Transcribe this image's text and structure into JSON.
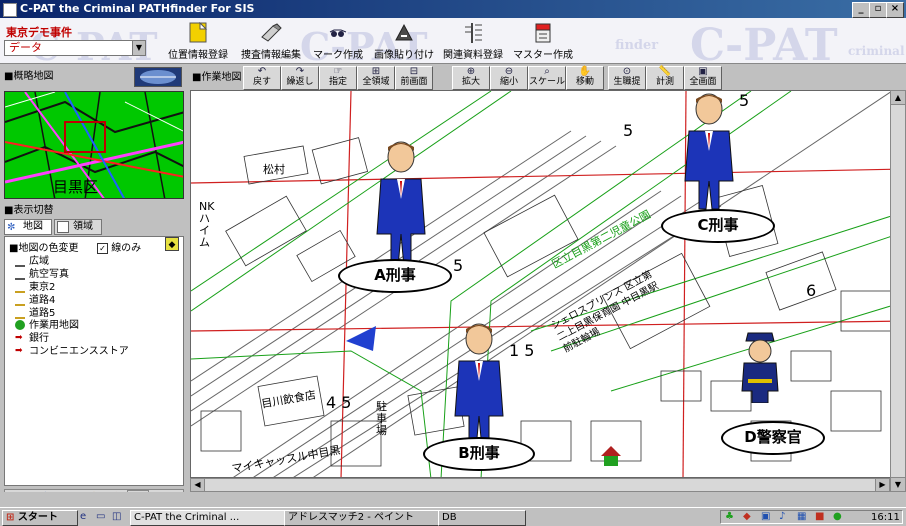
{
  "window": {
    "title": "C-PAT the Criminal PATHfinder For SIS"
  },
  "header": {
    "case_name": "東京デモ事件",
    "data_select": "データ",
    "watermark": "C-PAT",
    "watermark_suffix": "criminal",
    "watermark_fragment": "finder"
  },
  "toolbar": {
    "buttons": [
      {
        "label": "位置情報登録",
        "icon": "location-register-icon"
      },
      {
        "label": "捜査情報編集",
        "icon": "investigation-edit-icon"
      },
      {
        "label": "マーク作成",
        "icon": "mark-create-icon"
      },
      {
        "label": "画像貼り付け",
        "icon": "image-paste-icon"
      },
      {
        "label": "関連資料登録",
        "icon": "document-register-icon"
      },
      {
        "label": "マスター作成",
        "icon": "master-create-icon"
      }
    ]
  },
  "overview": {
    "title": "■概略地図",
    "area_label": "目黒区"
  },
  "display": {
    "title": "■表示切替",
    "tabs": [
      "地図",
      "領域"
    ],
    "color_change": "■地図の色変更",
    "lines_only": "線のみ",
    "layers": [
      "広域",
      "航空写真",
      "東京2",
      "道路4",
      "道路5",
      "作業用地図",
      "銀行",
      "コンビニエンスストア"
    ]
  },
  "map": {
    "title": "■作業地図",
    "tools": [
      "戻す",
      "繰返し",
      "指定",
      "全領域",
      "前画面",
      "拡大",
      "縮小",
      "スケール",
      "移動",
      "生職提",
      "計測",
      "全画面"
    ],
    "labels": {
      "a": "A刑事",
      "b": "B刑事",
      "c": "C刑事",
      "d": "D警察官",
      "matsumura": "松村",
      "heim": "NKハイム",
      "station": "区立目黒第二児童公園",
      "school": "シェロスプリンス 区立第二上目黒保育園 中目黒駅前駐輪場",
      "kawa": "目川飲食店",
      "parking": "駐車場",
      "meguro": "マイキャッスル中目黒",
      "num15": "1 5",
      "num45": "4 5",
      "num5": "5",
      "num6": "6"
    }
  },
  "taskbar": {
    "start": "スタート",
    "items": [
      "C-PAT the Criminal ...",
      "アドレスマッチ2 - ペイント",
      "DB"
    ],
    "clock": "16:11"
  }
}
